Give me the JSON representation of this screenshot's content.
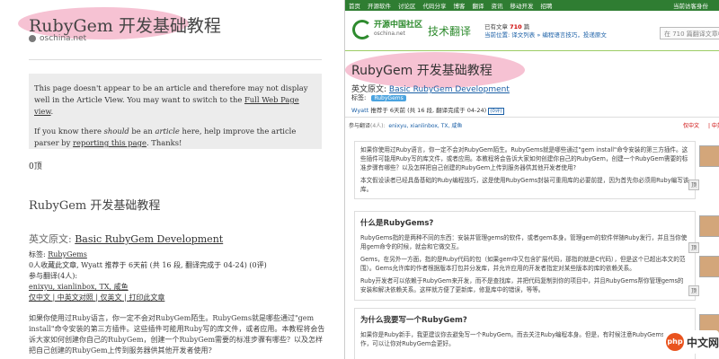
{
  "left": {
    "title": "RubyGem 开发基础教程",
    "site": "oschina.net",
    "notice_p1_a": "This page doesn't appear to be an article and therefore may not display well in the Article View. You may want to switch to the ",
    "notice_link1": "Full Web Page view",
    "notice_p1_b": ".",
    "notice_p2_a": "If you know there ",
    "notice_em1": "should",
    "notice_p2_b": " be an ",
    "notice_em2": "article",
    "notice_p2_c": " here, help improve the article parser by ",
    "notice_link2": "reporting this page",
    "notice_p2_d": ". Thanks!",
    "mark": "0顶",
    "heading": "RubyGem 开发基础教程",
    "orig_label": "英文原文: ",
    "orig_link": "Basic RubyGem Development",
    "tags_label": "标签: ",
    "tag": "RubyGems",
    "meta_line": "0人收藏此文章, Wyatt 推荐于 6天前 (共 16 段, 翻译完成于 04-24) (0评)",
    "participants_label": "参与翻译(4人):",
    "participants": "enixyu, xianlinbox, TX, 咸鱼",
    "view_links": "仅中文 | 中英文对照 | 仅英文 | 打印此文章",
    "body": "如果你使用过Ruby语言，你一定不会对RubyGem陌生。RubyGems就是哪些通过\"gem install\"命令安装的第三方插件。这些插件可能用Ruby写的库文件，或者应用。本教程将会告诉大家如何创建你自己的RubyGem，创建一个RubyGem需要的标准步骤有哪些？以及怎样把自己创建的RubyGem上传到服务器供其他开发者使用?"
  },
  "right": {
    "topbar": [
      "首页",
      "开源软件",
      "讨论区",
      "代码分享",
      "博客",
      "翻译",
      "资讯",
      "移动开发",
      "招聘"
    ],
    "topbar_right": "当前访客身份",
    "logo_main": "开源中国社区",
    "logo_sub": "oschina.net",
    "section": "技术翻译",
    "stats_prefix": "已有文章",
    "stats_count": "710",
    "stats_suffix": "篇",
    "stats_links": "当前位置: 译文列表 » 编程语言技巧，投递原文",
    "search_placeholder": "在 710 篇翻译文章中搜索",
    "title": "RubyGem 开发基础教程",
    "orig_label": "英文原文: ",
    "orig_link": "Basic RubyGem Development",
    "tags_label": "标签:",
    "tag": "RubyGems",
    "info_author": "Wyatt",
    "info_text": " 推荐于 6天前 (共 16 段, 翻译完成于 04-24) ",
    "info_zero": "(0评)",
    "participants_label": "参与翻译",
    "participants_count": "(4人):",
    "participants": "enixyu, xianlinbox, TX, 咸鱼",
    "only_cn": "仅中文",
    "cn_en": "| 中英",
    "intro_p1": "如果你使用过Ruby语言，你一定不会对RubyGem陌生。RubyGems就是哪些通过\"gem install\"命令安装的第三方插件。这些插件可能用Ruby写的库文件，或者应用。本教程将会告诉大家如何创建你自己的RubyGem，创建一个RubyGem需要的标准步骤有哪些？以及怎样把自己创建的RubyGem上传到服务器供其他开发者使用?",
    "intro_p2": "本文假设读者已经具备基础的Ruby编程技巧，这是使用RubyGems封装可重用库的必要前提，因为首先你必须用Ruby编写该库。",
    "h_what": "什么是RubyGems?",
    "what_p1": "RubyGems指的是两种不同的东西：安装并管理gems的软件，或者gem本身。管理gem的软件伴随Ruby发行，并且当你使用gem命令的时候，就会和它做交互。",
    "what_p2": "Gems，在另外一方面，指的是Ruby代码的包（如果gem中又包含扩展代码，那指的就是C代码），但是这个已超出本文的范围）。Gems允许库的作者根据版本打包并分发库，并允许应用的开发者指定对某些版本的库的依赖关系。",
    "what_p3": "Ruby开发者可以依赖于RubyGem来开发，而不是查找库，并把代码复制到你的项目中，并且RubyGems帮你管理gems的安装和解决依赖关系。这样就方便了更新库，修复库中的错误，等等。",
    "h_why": "为什么我要写一个RubyGem?",
    "why_p1": "如果你是Ruby新手，我更建议你去避免写一个RubyGem。而去关注Ruby编程本身。但是，有时候注意RubyGems的内部运作，可以让你对RubyGem会更好。",
    "ding": "顶",
    "watermark": "中文网",
    "watermark_logo": "php"
  }
}
